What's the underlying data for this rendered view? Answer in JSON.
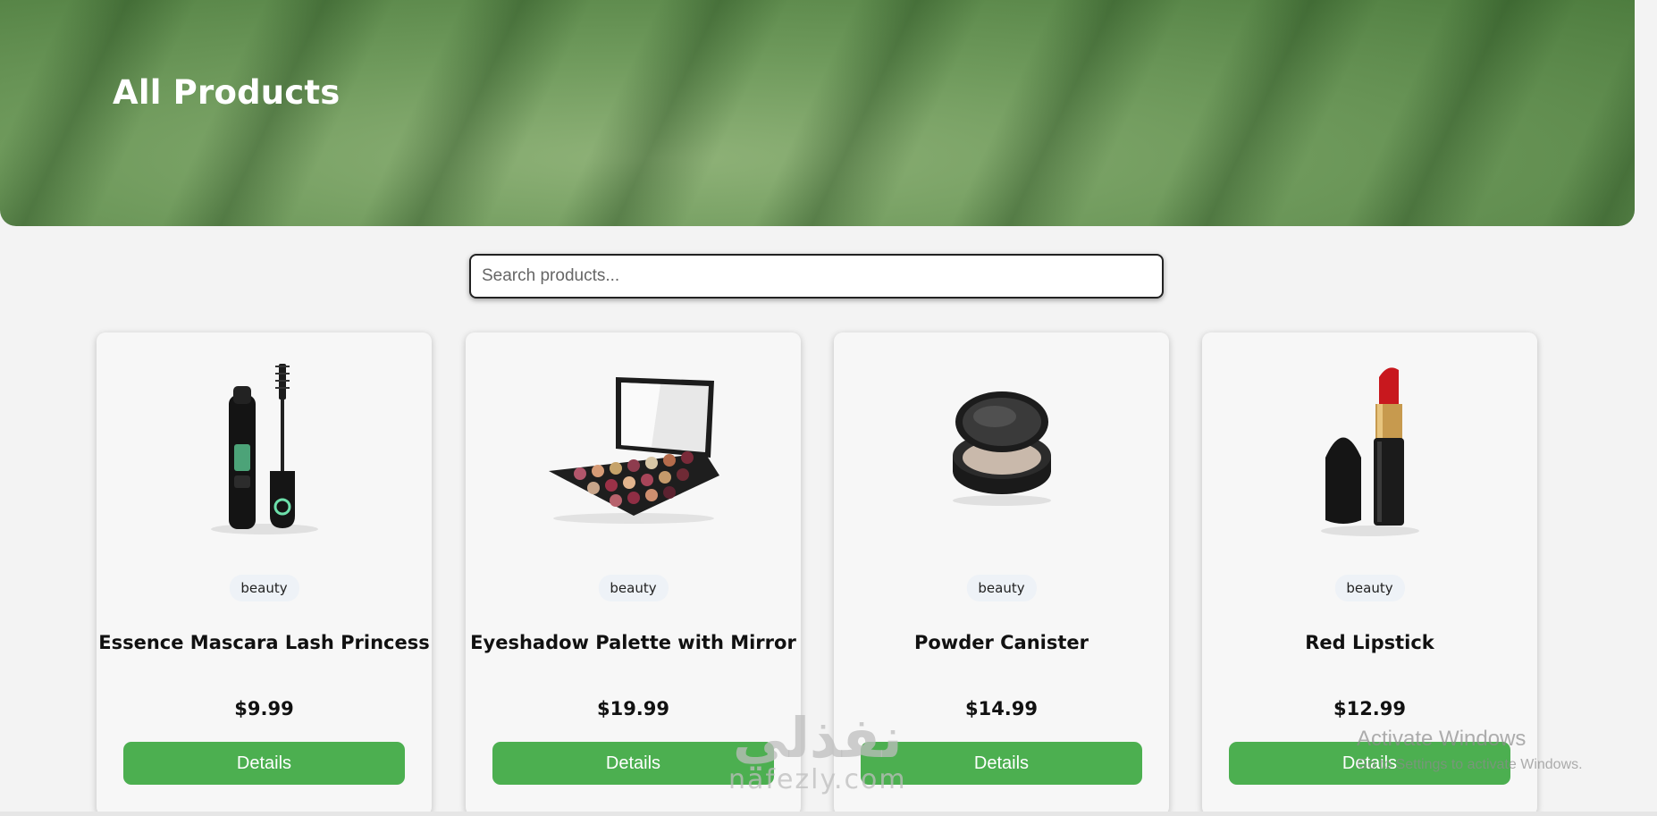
{
  "header": {
    "title": "All Products"
  },
  "search": {
    "placeholder": "Search products...",
    "value": ""
  },
  "products": [
    {
      "category": "beauty",
      "title": "Essence Mascara Lash Princess",
      "price": "$9.99",
      "button_label": "Details",
      "image_icon": "mascara-image"
    },
    {
      "category": "beauty",
      "title": "Eyeshadow Palette with Mirror",
      "price": "$19.99",
      "button_label": "Details",
      "image_icon": "eyeshadow-palette-image"
    },
    {
      "category": "beauty",
      "title": "Powder Canister",
      "price": "$14.99",
      "button_label": "Details",
      "image_icon": "powder-compact-image"
    },
    {
      "category": "beauty",
      "title": "Red Lipstick",
      "price": "$12.99",
      "button_label": "Details",
      "image_icon": "lipstick-image"
    }
  ],
  "watermark": {
    "arabic": "نفذلي",
    "latin": "nafezly.com"
  },
  "os_overlay": {
    "line1": "Activate Windows",
    "line2": "Go to Settings to activate Windows."
  },
  "colors": {
    "accent": "#4caf50",
    "hero": "#6f9a5c",
    "background": "#f3f3f3",
    "card": "#f7f7f7"
  }
}
